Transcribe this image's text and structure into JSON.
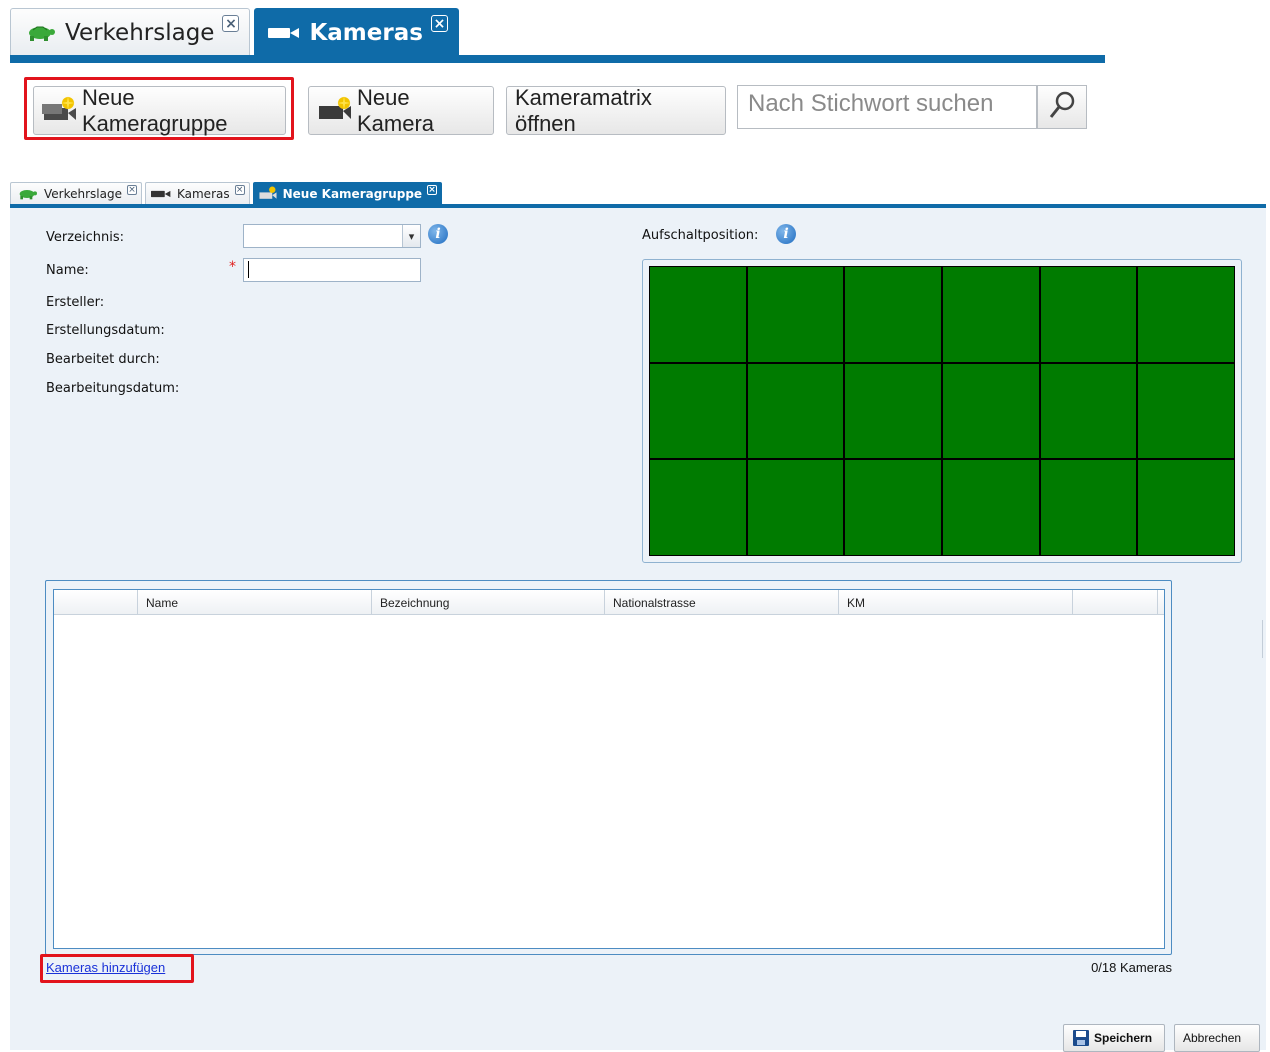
{
  "zoomed": {
    "tabs": [
      {
        "label": "Verkehrslage",
        "icon": "turtle-icon",
        "active": false
      },
      {
        "label": "Kameras",
        "icon": "camera-icon",
        "active": true
      }
    ],
    "toolbar": {
      "new_group_label": "Neue Kameragruppe",
      "new_camera_label": "Neue Kamera",
      "matrix_label": "Kameramatrix öffnen",
      "search_placeholder": "Nach Stichwort suchen"
    }
  },
  "tabs": [
    {
      "label": "Verkehrslage",
      "icon": "turtle-icon",
      "active": false
    },
    {
      "label": "Kameras",
      "icon": "camera-icon",
      "active": false
    },
    {
      "label": "Neue Kameragruppe",
      "icon": "camera-group-icon",
      "active": true
    }
  ],
  "form": {
    "directory_label": "Verzeichnis:",
    "directory_value": "",
    "name_label": "Name:",
    "name_value": "",
    "required_marker": "*",
    "creator_label": "Ersteller:",
    "created_date_label": "Erstellungsdatum:",
    "edited_by_label": "Bearbeitet durch:",
    "edited_date_label": "Bearbeitungsdatum:",
    "position_label": "Aufschaltposition:"
  },
  "matrix": {
    "rows": 3,
    "cols": 6,
    "cell_color": "#007b00"
  },
  "table": {
    "columns": [
      "",
      "Name",
      "Bezeichnung",
      "Nationalstrasse",
      "KM",
      ""
    ],
    "rows": []
  },
  "footer": {
    "add_link": "Kameras hinzufügen",
    "count": "0/18 Kameras",
    "save_label": "Speichern",
    "cancel_label": "Abbrechen"
  },
  "colors": {
    "accent": "#0f6ba8",
    "highlight": "#e2141c",
    "link": "#1a32d8"
  }
}
